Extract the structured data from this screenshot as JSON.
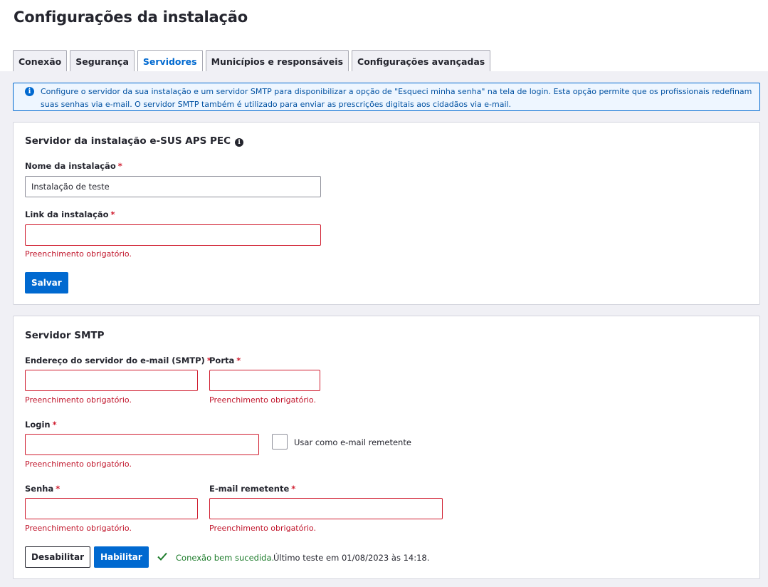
{
  "page": {
    "title": "Configurações da instalação"
  },
  "tabs": [
    {
      "label": "Conexão"
    },
    {
      "label": "Segurança"
    },
    {
      "label": "Servidores"
    },
    {
      "label": "Municípios e responsáveis"
    },
    {
      "label": "Configurações avançadas"
    }
  ],
  "active_tab": "Servidores",
  "info": {
    "icon": "info-icon",
    "line1": "Configure o servidor da sua instalação e um servidor SMTP para disponibilizar a opção de \"Esqueci minha senha\" na tela de login. Esta opção permite que os profissionais redefinam",
    "line2": "suas senhas via e-mail. O servidor SMTP também é utilizado para enviar as prescrições digitais aos cidadãos via e-mail."
  },
  "installation": {
    "title": "Servidor da instalação e-SUS APS PEC",
    "name_label": "Nome da instalação",
    "name_value": "Instalação de teste",
    "link_label": "Link da instalação",
    "link_value": "",
    "link_error": "Preenchimento obrigatório.",
    "save_label": "Salvar"
  },
  "smtp": {
    "title": "Servidor SMTP",
    "server_label": "Endereço do servidor do e-mail (SMTP)",
    "server_error": "Preenchimento obrigatório.",
    "port_label": "Porta",
    "port_error": "Preenchimento obrigatório.",
    "login_label": "Login",
    "login_error": "Preenchimento obrigatório.",
    "use_as_sender_label": "Usar como e-mail remetente",
    "password_label": "Senha",
    "password_error": "Preenchimento obrigatório.",
    "sender_label": "E-mail remetente",
    "sender_error": "Preenchimento obrigatório.",
    "disable_label": "Desabilitar",
    "enable_label": "Habilitar",
    "status_ok": "Conexão bem sucedida.",
    "status_note": "Último teste em 01/08/2023 às 14:18."
  },
  "required_mark": "*",
  "colors": {
    "primary": "#0069d0",
    "error": "#d01e30",
    "success": "#1d7c2b"
  }
}
